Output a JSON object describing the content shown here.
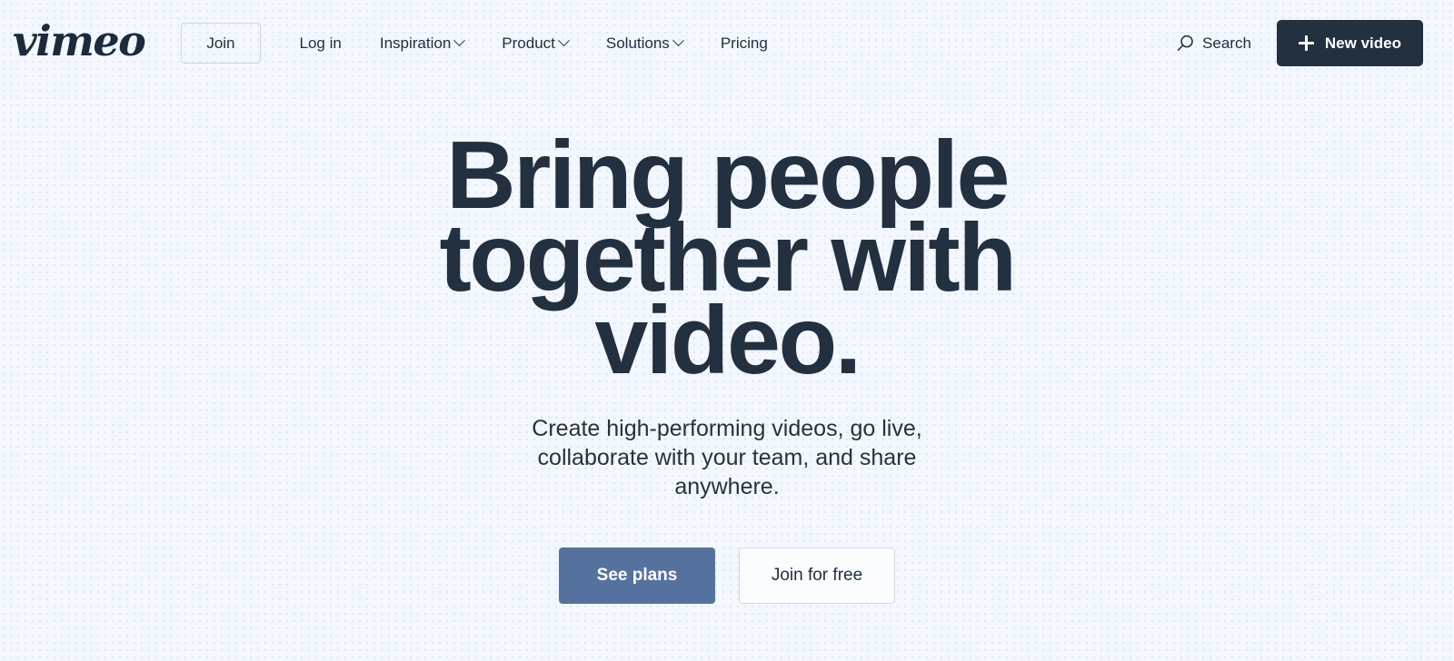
{
  "brand": {
    "logo_text": "vimeo"
  },
  "header": {
    "join_label": "Join",
    "login_label": "Log in",
    "nav_items": [
      {
        "label": "Inspiration",
        "has_chevron": true
      },
      {
        "label": "Product",
        "has_chevron": true
      },
      {
        "label": "Solutions",
        "has_chevron": true
      },
      {
        "label": "Pricing",
        "has_chevron": false
      }
    ],
    "search_label": "Search",
    "new_video_label": "New video"
  },
  "hero": {
    "headline_line_1": "Bring people",
    "headline_line_2": "together with",
    "headline_line_3": "video.",
    "subheading": "Create high-performing videos, go live, collaborate with your team, and share anywhere.",
    "primary_cta": "See plans",
    "secondary_cta": "Join for free"
  },
  "colors": {
    "page_background": "#f3f7fe",
    "dot_pattern": "#d9e3f5",
    "text_dark": "#1f2e3d",
    "headline": "#22303f",
    "primary_button": "#55729f",
    "dark_button": "#23303f",
    "border": "#ccd6e4"
  }
}
